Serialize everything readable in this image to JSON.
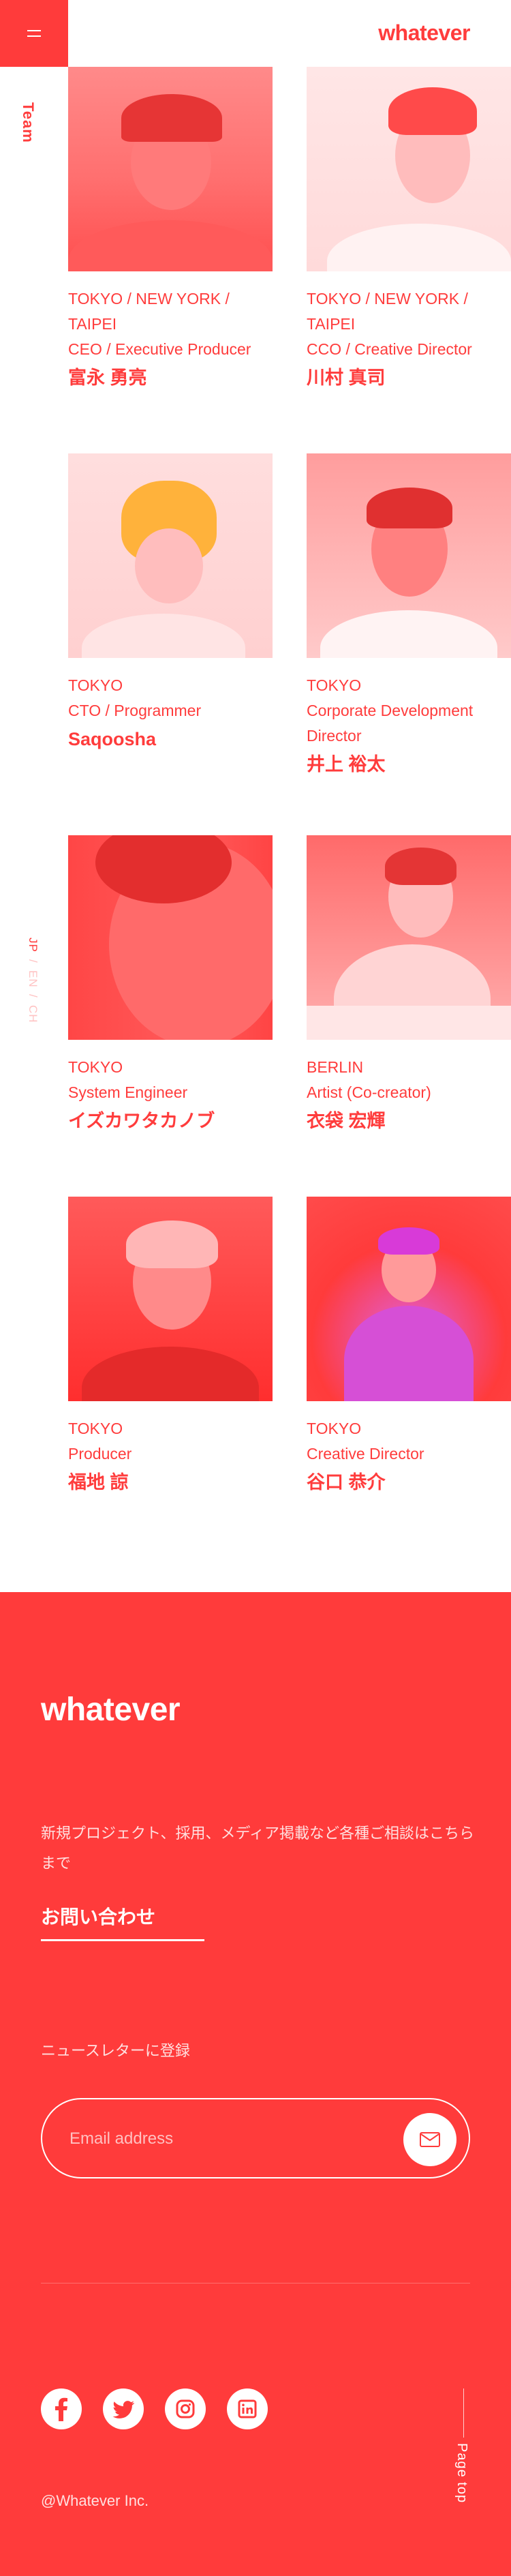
{
  "header": {
    "logo": "whatever",
    "menu_icon": "hamburger-icon"
  },
  "rail": {
    "section": "Team",
    "languages": [
      "JP",
      "EN",
      "CH"
    ],
    "separator": "/"
  },
  "members": [
    {
      "location": "TOKYO / NEW YORK / TAIPEI",
      "role": "CEO / Executive Producer",
      "name": "富永 勇亮"
    },
    {
      "location": "TOKYO / NEW YORK / TAIPEI",
      "role": "CCO / Creative Director",
      "name": "川村 真司"
    },
    {
      "location": "TOKYO",
      "role": "CTO / Programmer",
      "name": "Saqoosha"
    },
    {
      "location": "TOKYO",
      "role": "Corporate Development Director",
      "name": "井上 裕太"
    },
    {
      "location": "TOKYO",
      "role": "System Engineer",
      "name": "イズカワタカノブ"
    },
    {
      "location": "BERLIN",
      "role": "Artist (Co-creator)",
      "name": "衣袋 宏輝"
    },
    {
      "location": "TOKYO",
      "role": "Producer",
      "name": "福地 諒"
    },
    {
      "location": "TOKYO",
      "role": "Creative Director",
      "name": "谷口 恭介"
    }
  ],
  "footer": {
    "logo": "whatever",
    "description": "新規プロジェクト、採用、メディア掲載など各種ご相談はこちらまで",
    "contact_label": "お問い合わせ",
    "newsletter_label": "ニュースレターに登録",
    "email_placeholder": "Email address",
    "send_icon": "envelope-icon",
    "socials": [
      "facebook-icon",
      "twitter-icon",
      "instagram-icon",
      "linkedin-icon"
    ],
    "copyright": "@Whatever Inc.",
    "page_top": "Page top"
  },
  "colors": {
    "accent": "#ff3b3b",
    "text_on_accent": "#ffffff",
    "muted_on_accent": "#ffe0e0"
  }
}
